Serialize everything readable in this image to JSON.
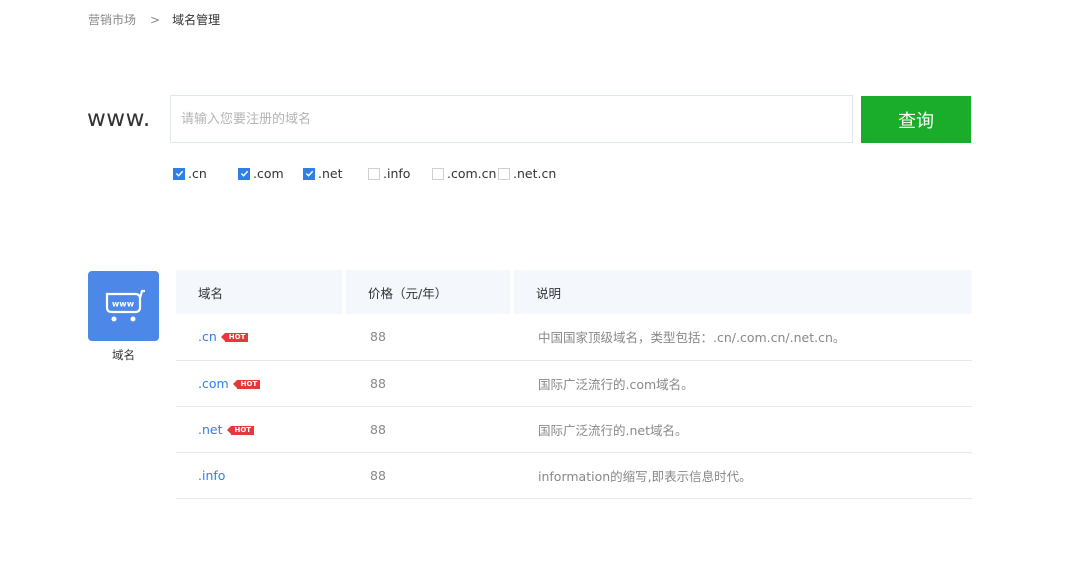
{
  "breadcrumb": {
    "parent": "营销市场",
    "separator": ">",
    "current": "域名管理"
  },
  "search": {
    "prefix": "www.",
    "placeholder": "请输入您要注册的域名",
    "button_label": "查询"
  },
  "tld_options": [
    {
      "label": ".cn",
      "checked": true
    },
    {
      "label": ".com",
      "checked": true
    },
    {
      "label": ".net",
      "checked": true
    },
    {
      "label": ".info",
      "checked": false
    },
    {
      "label": ".com.cn",
      "checked": false
    },
    {
      "label": ".net.cn",
      "checked": false
    }
  ],
  "product": {
    "icon": "www-cart-icon",
    "label": "域名"
  },
  "table": {
    "headers": [
      "域名",
      "价格（元/年）",
      "说明"
    ],
    "rows": [
      {
        "name": ".cn",
        "hot": true,
        "hot_label": "HOT",
        "price": "88",
        "desc": "中国国家顶级域名，类型包括：.cn/.com.cn/.net.cn。"
      },
      {
        "name": ".com",
        "hot": true,
        "hot_label": "HOT",
        "price": "88",
        "desc": "国际广泛流行的.com域名。"
      },
      {
        "name": ".net",
        "hot": true,
        "hot_label": "HOT",
        "price": "88",
        "desc": "国际广泛流行的.net域名。"
      },
      {
        "name": ".info",
        "hot": false,
        "price": "88",
        "desc": "information的缩写,即表示信息时代。"
      }
    ]
  },
  "colors": {
    "accent_blue": "#2f7fe6",
    "search_green": "#1aad2b",
    "hot_red": "#e4393c",
    "icon_bg": "#4d88e8"
  }
}
